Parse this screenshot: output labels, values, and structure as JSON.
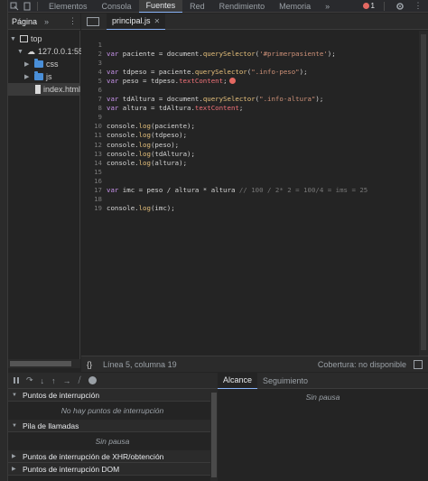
{
  "toolbar": {
    "tabs": [
      "Elementos",
      "Consola",
      "Fuentes",
      "Red",
      "Rendimiento",
      "Memoria"
    ],
    "active_tab": "Fuentes",
    "more": "»",
    "error_count": "1"
  },
  "navigator": {
    "tab": "Página",
    "more": "»",
    "tree": {
      "top": "top",
      "host": "127.0.0.1:55C",
      "css": "css",
      "js": "js",
      "file": "index.html"
    }
  },
  "editor": {
    "file_tab": "principal.js",
    "lines": [
      {
        "n": "1",
        "segs": []
      },
      {
        "n": "2",
        "segs": [
          {
            "c": "k",
            "t": "var"
          },
          {
            "c": "lt",
            "t": " paciente = document."
          },
          {
            "c": "f",
            "t": "querySelector"
          },
          {
            "c": "lt",
            "t": "("
          },
          {
            "c": "s",
            "t": "'#primerpasiente'"
          },
          {
            "c": "lt",
            "t": ");"
          }
        ]
      },
      {
        "n": "3",
        "segs": []
      },
      {
        "n": "4",
        "segs": [
          {
            "c": "k",
            "t": "var"
          },
          {
            "c": "lt",
            "t": " tdpeso = paciente."
          },
          {
            "c": "f",
            "t": "querySelector"
          },
          {
            "c": "lt",
            "t": "("
          },
          {
            "c": "s",
            "t": "\".info-peso\""
          },
          {
            "c": "lt",
            "t": ");"
          }
        ]
      },
      {
        "n": "5",
        "segs": [
          {
            "c": "k",
            "t": "var"
          },
          {
            "c": "lt",
            "t": " peso = tdpeso."
          },
          {
            "c": "p",
            "t": "textContent"
          },
          {
            "c": "lt",
            "t": ";"
          }
        ],
        "error": true
      },
      {
        "n": "6",
        "segs": []
      },
      {
        "n": "7",
        "segs": [
          {
            "c": "k",
            "t": "var"
          },
          {
            "c": "lt",
            "t": " tdAltura = document."
          },
          {
            "c": "f",
            "t": "querySelector"
          },
          {
            "c": "lt",
            "t": "("
          },
          {
            "c": "s",
            "t": "\".info-altura\""
          },
          {
            "c": "lt",
            "t": ");"
          }
        ]
      },
      {
        "n": "8",
        "segs": [
          {
            "c": "k",
            "t": "var"
          },
          {
            "c": "lt",
            "t": " altura = tdAltura."
          },
          {
            "c": "p",
            "t": "textContent"
          },
          {
            "c": "lt",
            "t": ";"
          }
        ]
      },
      {
        "n": "9",
        "segs": []
      },
      {
        "n": "10",
        "segs": [
          {
            "c": "lt",
            "t": "console."
          },
          {
            "c": "f",
            "t": "log"
          },
          {
            "c": "lt",
            "t": "(paciente);"
          }
        ]
      },
      {
        "n": "11",
        "segs": [
          {
            "c": "lt",
            "t": "console."
          },
          {
            "c": "f",
            "t": "log"
          },
          {
            "c": "lt",
            "t": "(tdpeso);"
          }
        ]
      },
      {
        "n": "12",
        "segs": [
          {
            "c": "lt",
            "t": "console."
          },
          {
            "c": "f",
            "t": "log"
          },
          {
            "c": "lt",
            "t": "(peso);"
          }
        ]
      },
      {
        "n": "13",
        "segs": [
          {
            "c": "lt",
            "t": "console."
          },
          {
            "c": "f",
            "t": "log"
          },
          {
            "c": "lt",
            "t": "(tdAltura);"
          }
        ]
      },
      {
        "n": "14",
        "segs": [
          {
            "c": "lt",
            "t": "console."
          },
          {
            "c": "f",
            "t": "log"
          },
          {
            "c": "lt",
            "t": "(altura);"
          }
        ]
      },
      {
        "n": "15",
        "segs": []
      },
      {
        "n": "16",
        "segs": []
      },
      {
        "n": "17",
        "segs": [
          {
            "c": "k",
            "t": "var"
          },
          {
            "c": "lt",
            "t": " imc = peso / altura * altura "
          },
          {
            "c": "cm",
            "t": "// 100 / 2* 2 = 100/4 = ims = 25"
          }
        ]
      },
      {
        "n": "18",
        "segs": []
      },
      {
        "n": "19",
        "segs": [
          {
            "c": "lt",
            "t": "console."
          },
          {
            "c": "f",
            "t": "log"
          },
          {
            "c": "lt",
            "t": "(imc);"
          }
        ]
      }
    ]
  },
  "status": {
    "braces": "{}",
    "position": "Línea 5, columna 19",
    "coverage": "Cobertura: no disponible"
  },
  "debugger": {
    "sections": [
      {
        "title": "Puntos de interrupción",
        "expanded": true,
        "body": "No hay puntos de interrupción"
      },
      {
        "title": "Pila de llamadas",
        "expanded": true,
        "body": "Sin pausa"
      },
      {
        "title": "Puntos de interrupción de XHR/obtención",
        "expanded": false
      },
      {
        "title": "Puntos de interrupción DOM",
        "expanded": false
      }
    ]
  },
  "scope": {
    "tabs": [
      "Alcance",
      "Seguimiento"
    ],
    "active": "Alcance",
    "empty": "Sin pausa"
  },
  "colors": {
    "accent": "#8ab4f8",
    "error": "#e46962",
    "folder": "#4a8fd8"
  }
}
